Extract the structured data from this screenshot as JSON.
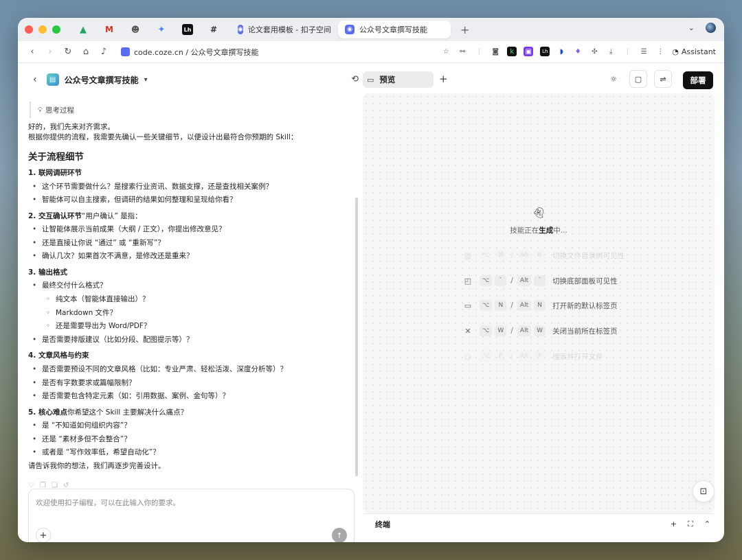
{
  "browser": {
    "tabs": [
      {
        "label": "论文套用模板 - 扣子空间",
        "active": false
      },
      {
        "label": "公众号文章撰写技能",
        "active": true
      }
    ],
    "pinned_tab_icons": [
      "google-drive-icon",
      "gmail-icon",
      "mascot-icon",
      "gemini-icon",
      "lark-icon",
      "slack-icon"
    ],
    "url": "code.coze.cn / 公众号文章撰写技能",
    "assistant_label": "Assistant",
    "new_tab_glyph": "+"
  },
  "left": {
    "title": "公众号文章撰写技能",
    "thinking_label": "思考过程",
    "intro_lines": [
      "好的，我们先来对齐需求。",
      "根据你提供的流程，我需要先确认一些关键细节，以便设计出最符合你预期的 Skill："
    ],
    "heading": "关于流程细节",
    "sections": [
      {
        "title": "1. 联网调研环节",
        "rest": "",
        "items": [
          {
            "text": "这个环节需要做什么？是搜索行业资讯、数据支撑，还是查找相关案例？"
          },
          {
            "text": "智能体可以自主搜索，但调研的结果如何整理和呈现给你看？"
          }
        ]
      },
      {
        "title": "2. 交互确认环节",
        "rest": "“用户确认” 是指：",
        "items": [
          {
            "text": "让智能体展示当前成果（大纲 / 正文），你提出修改意见？"
          },
          {
            "text": "还是直接让你说 “通过” 或 “重新写”？"
          },
          {
            "text": "确认几次？如果首次不满意，是修改还是重来？"
          }
        ]
      },
      {
        "title": "3. 输出格式",
        "rest": "",
        "items": [
          {
            "text": "最终交付什么格式？",
            "sub": [
              "纯文本（智能体直接输出）？",
              "Markdown 文件？",
              "还是需要导出为 Word/PDF？"
            ]
          },
          {
            "text": "是否需要排版建议（比如分段、配图提示等）？"
          }
        ]
      },
      {
        "title": "4. 文章风格与约束",
        "rest": "",
        "items": [
          {
            "text": "是否需要预设不同的文章风格（比如：专业严肃、轻松活泼、深度分析等）？"
          },
          {
            "text": "是否有字数要求或篇幅限制？"
          },
          {
            "text": "是否需要包含特定元素（如：引用数据、案例、金句等）？"
          }
        ]
      },
      {
        "title": "5. 核心难点",
        "rest": "你希望这个 Skill 主要解决什么痛点？",
        "items": [
          {
            "text": "是 “不知道如何组织内容”？"
          },
          {
            "text": "还是 “素材多但不会整合”？"
          },
          {
            "text": "或者是 “写作效率低，希望自动化”？"
          }
        ]
      }
    ],
    "closing": "请告诉我你的想法，我们再逐步完善设计。",
    "composer_placeholder": "欢迎使用扣子编程，可以在此输入你的要求。"
  },
  "right": {
    "preview_tab": "预览",
    "deploy_label": "部署",
    "generating_prefix": "技能正在",
    "generating_bold": "生成",
    "generating_suffix": "中...",
    "terminal_label": "终端",
    "shortcuts": [
      {
        "icon": "sidebar-icon",
        "keys1": [
          "⌥",
          "⌘"
        ],
        "keys2": [
          "Alt",
          "B"
        ],
        "desc": "切换文件目录树可见性",
        "faded": true
      },
      {
        "icon": "panel-icon",
        "keys1": [
          "⌥",
          "`"
        ],
        "keys2": [
          "Alt",
          "`"
        ],
        "desc": "切换底部面板可见性",
        "faded": false
      },
      {
        "icon": "browser-tab-icon",
        "keys1": [
          "⌥",
          "N"
        ],
        "keys2": [
          "Alt",
          "N"
        ],
        "desc": "打开新的默认标签页",
        "faded": false
      },
      {
        "icon": "close-icon",
        "keys1": [
          "⌥",
          "W"
        ],
        "keys2": [
          "Alt",
          "W"
        ],
        "desc": "关闭当前所在标签页",
        "faded": false
      },
      {
        "icon": "search-icon",
        "keys1": [
          "⌥",
          "P"
        ],
        "keys2": [
          "Alt",
          "P"
        ],
        "desc": "搜索并打开文件",
        "faded": true
      }
    ]
  },
  "colors": {
    "accent": "#5b6cf0",
    "deploy_bg": "#111111",
    "traffic_red": "#ff5f57",
    "traffic_yellow": "#febc2e",
    "traffic_green": "#28c840"
  }
}
